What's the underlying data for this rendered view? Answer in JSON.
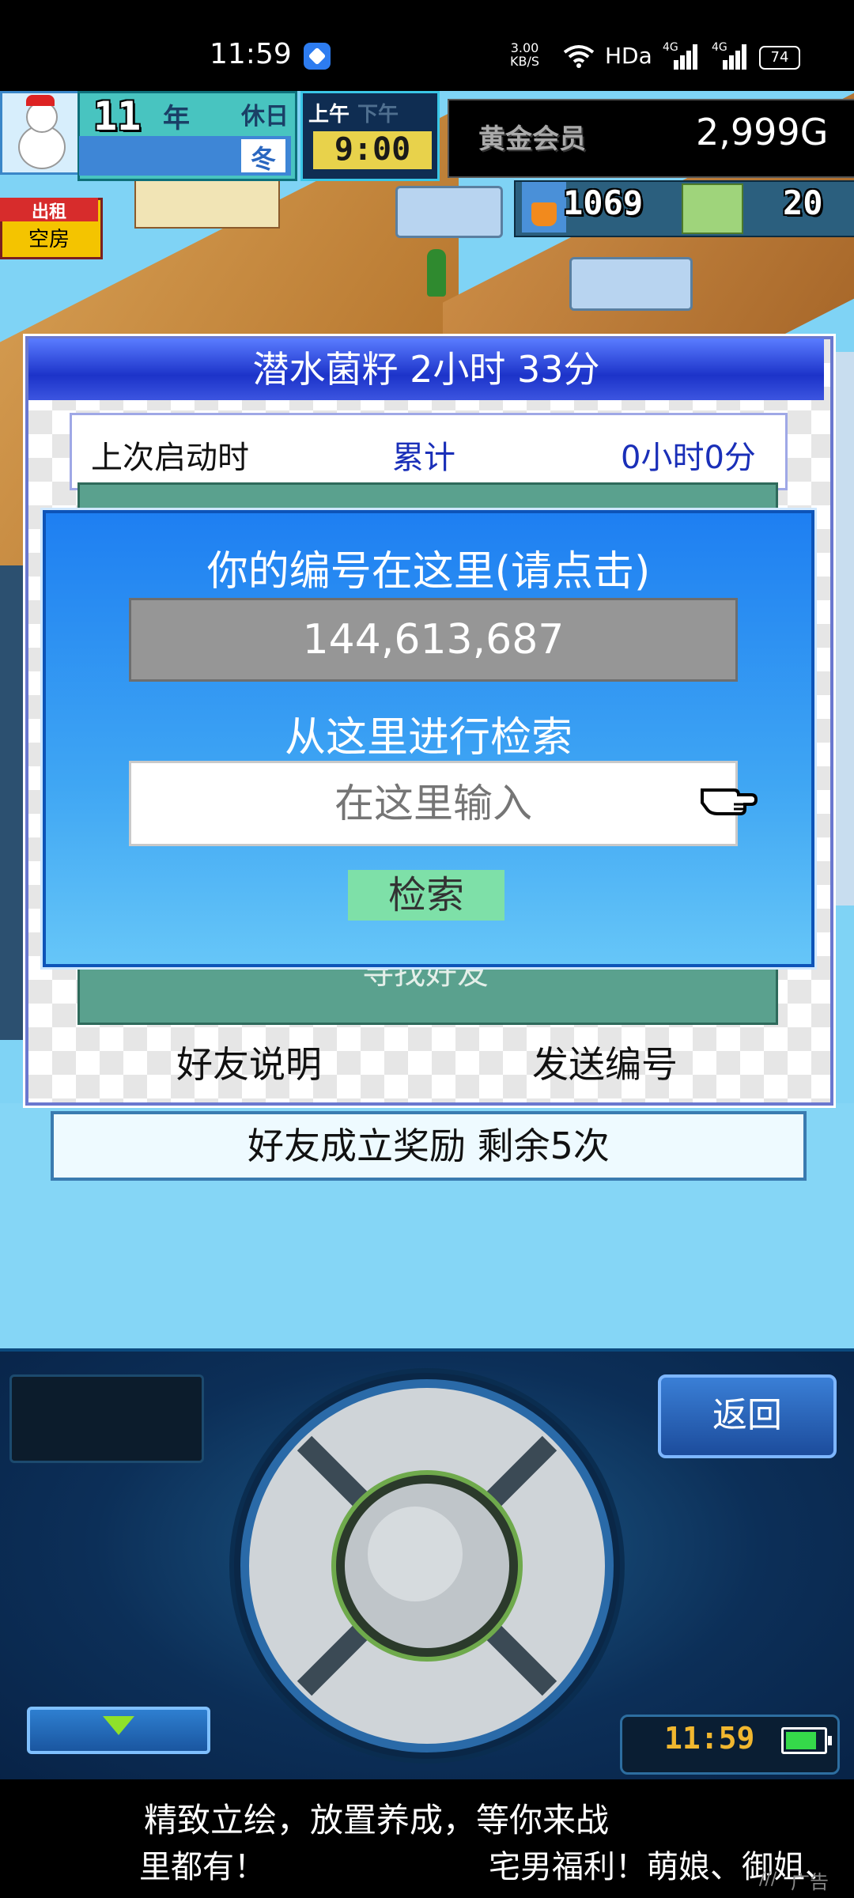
{
  "status_bar": {
    "time": "11:59",
    "net_speed_value": "3.00",
    "net_speed_unit": "KB/S",
    "hd_label": "HDa",
    "signal_label_1": "4G",
    "signal_label_2": "4G",
    "battery": "74"
  },
  "hud": {
    "year_number": "11",
    "year_unit": "年",
    "holiday_label": "休日",
    "season": "冬",
    "am_label": "上午",
    "pm_label": "下午",
    "clock": "9:00",
    "member_label": "黄金会员",
    "money": "2,999G",
    "research_points": "1069",
    "count": "20",
    "rent_top": "出租",
    "rent_bottom": "空房"
  },
  "dialog": {
    "title": "潜水菌籽  2小时 33分",
    "info_label": "上次启动时",
    "info_total_label": "累计",
    "info_value": "0小时0分",
    "find_friend_label": "寻找好友",
    "friend_info_button": "好友说明",
    "send_id_button": "发送编号",
    "reward_bar": "好友成立奖励  剩余5次"
  },
  "popup": {
    "id_title": "你的编号在这里(请点击)",
    "id_value": "144,613,687",
    "search_title": "从这里进行检索",
    "search_placeholder": "在这里输入",
    "search_button": "检索"
  },
  "controller": {
    "back_button": "返回",
    "clock": "11:59"
  },
  "ad": {
    "line1": "精致立绘，放置养成，等你来战",
    "line2a": "里都有！",
    "line2b": "宅男福利！萌娘、御姐、",
    "tag": "广告"
  },
  "colors": {
    "dialog_title_blue": "#1c33c9",
    "popup_blue": "#1e7ff2",
    "search_button_green": "#7ee0a8",
    "panel_green": "#5aa18e",
    "money_text": "#ffffff"
  }
}
